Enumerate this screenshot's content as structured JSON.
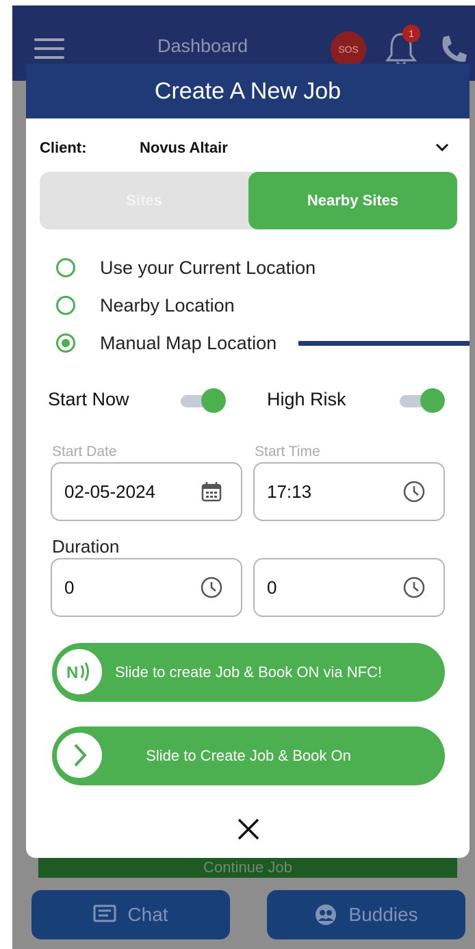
{
  "background": {
    "header_title": "Dashboard",
    "sos_label": "SOS",
    "notification_count": "1",
    "continue_label": "Continue Job",
    "tabs": [
      {
        "label": "Chat",
        "icon": "chat-icon"
      },
      {
        "label": "Buddies",
        "icon": "buddies-icon"
      }
    ]
  },
  "modal": {
    "title": "Create A New Job",
    "client_label": "Client:",
    "client_value": "Novus Altair",
    "segment": {
      "left": "Sites",
      "right": "Nearby Sites",
      "selected": "Nearby Sites"
    },
    "location_options": [
      {
        "label": "Use your Current Location",
        "checked": false
      },
      {
        "label": "Nearby Location",
        "checked": false
      },
      {
        "label": "Manual Map Location",
        "checked": true
      }
    ],
    "start_now": {
      "label": "Start Now",
      "on": true
    },
    "high_risk": {
      "label": "High Risk",
      "on": true
    },
    "start_date": {
      "label": "Start Date",
      "value": "02-05-2024"
    },
    "start_time": {
      "label": "Start Time",
      "value": "17:13"
    },
    "duration": {
      "label": "Duration",
      "hours": "0",
      "minutes": "0"
    },
    "nfc_slider": "Slide to create Job & Book ON via NFC!",
    "book_slider": "Slide to Create Job & Book On"
  },
  "colors": {
    "header_navy": "#203a78",
    "accent_green": "#4caf50",
    "app_header": "#202f66"
  }
}
